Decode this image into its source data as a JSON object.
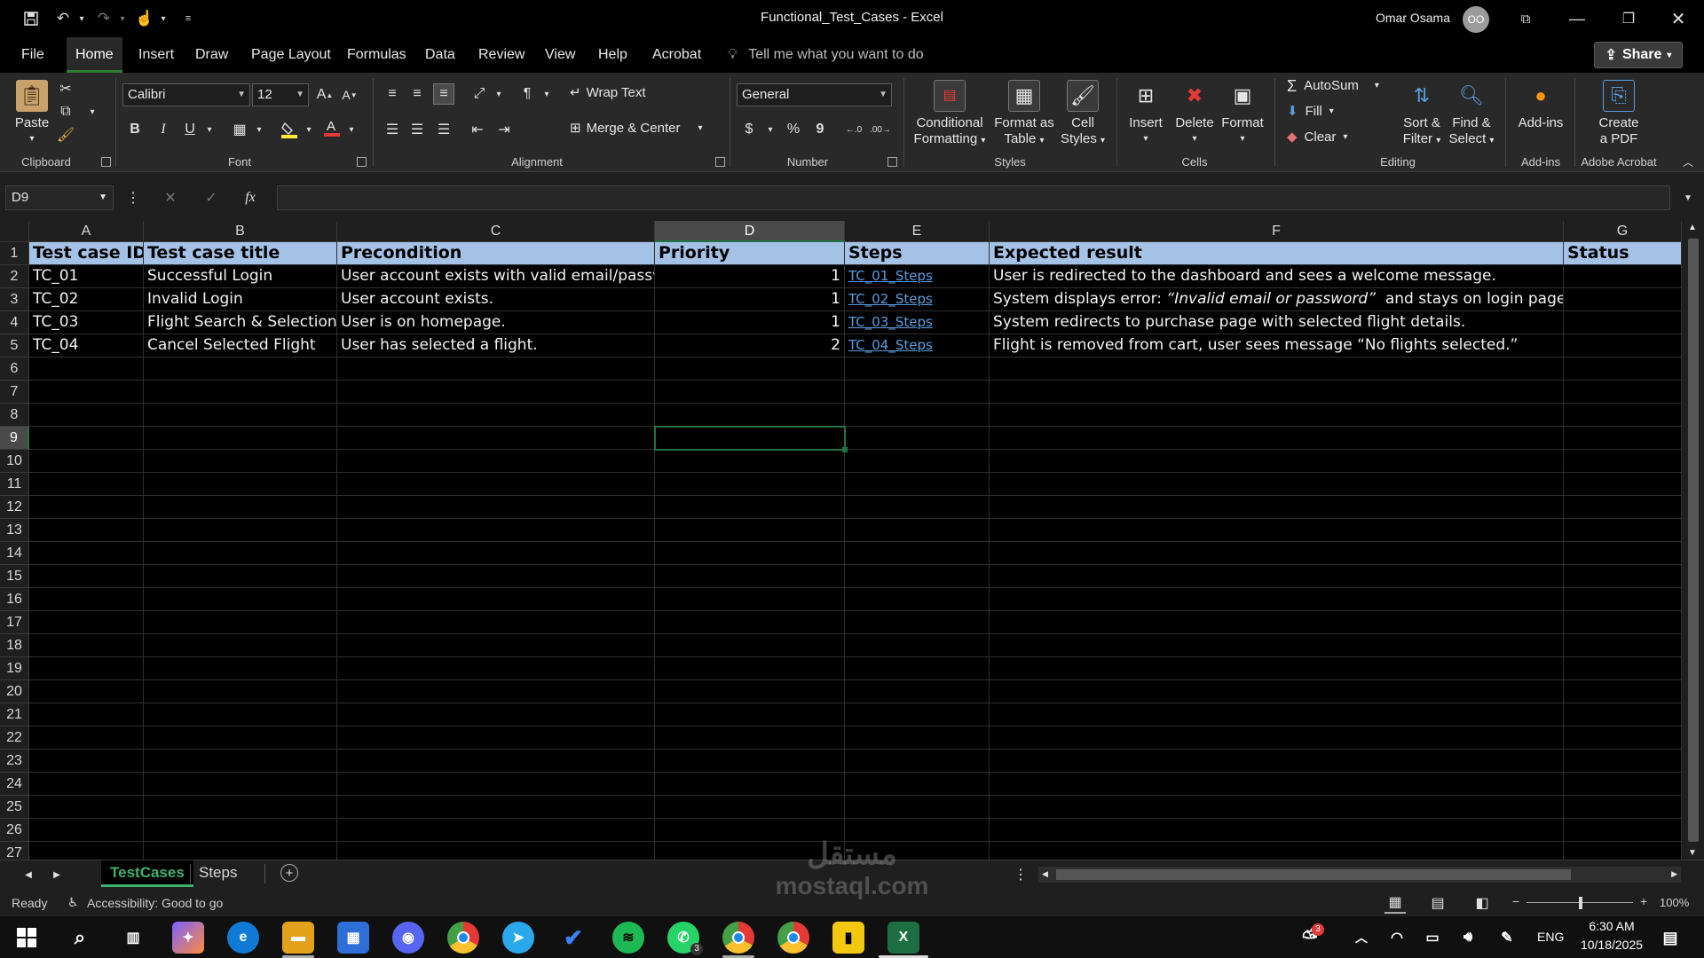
{
  "window": {
    "title": "Functional_Test_Cases  -  Excel",
    "user_name": "Omar Osama",
    "avatar_text": "OO"
  },
  "tabs": [
    "File",
    "Home",
    "Insert",
    "Draw",
    "Page Layout",
    "Formulas",
    "Data",
    "Review",
    "View",
    "Help",
    "Acrobat"
  ],
  "tell_me": "Tell me what you want to do",
  "share_label": "Share",
  "ribbon": {
    "clipboard": {
      "paste": "Paste",
      "label": "Clipboard"
    },
    "font": {
      "name": "Calibri",
      "size": "12",
      "label": "Font",
      "bold": "B",
      "italic": "I",
      "underline": "U"
    },
    "alignment": {
      "wrap": "Wrap Text",
      "merge": "Merge & Center",
      "label": "Alignment"
    },
    "number": {
      "format": "General",
      "label": "Number",
      "currency": "$",
      "percent": "%",
      "comma": "9"
    },
    "styles": {
      "conditional_1": "Conditional",
      "conditional_2": "Formatting",
      "format_table_1": "Format as",
      "format_table_2": "Table",
      "cell_styles_1": "Cell",
      "cell_styles_2": "Styles",
      "label": "Styles"
    },
    "cells": {
      "insert": "Insert",
      "delete": "Delete",
      "format": "Format",
      "label": "Cells"
    },
    "editing": {
      "autosum": "AutoSum",
      "fill": "Fill",
      "clear": "Clear",
      "sort_1": "Sort &",
      "sort_2": "Filter",
      "find_1": "Find &",
      "find_2": "Select",
      "label": "Editing"
    },
    "addins": {
      "button": "Add-ins",
      "label": "Add-ins"
    },
    "acrobat": {
      "btn_1": "Create",
      "btn_2": "a PDF",
      "label": "Adobe Acrobat"
    }
  },
  "formula_bar": {
    "name_box": "D9",
    "fx": "fx",
    "value": ""
  },
  "columns": [
    "A",
    "B",
    "C",
    "D",
    "E",
    "F",
    "G"
  ],
  "rows": [
    "1",
    "2",
    "3",
    "4",
    "5",
    "6",
    "7",
    "8",
    "9",
    "10",
    "11",
    "12",
    "13",
    "14",
    "15",
    "16",
    "17",
    "18",
    "19",
    "20",
    "21",
    "22",
    "23",
    "24",
    "25",
    "26",
    "27"
  ],
  "header_row": [
    "Test case ID",
    "Test case title",
    "Precondition",
    "Priority",
    "Steps",
    "Expected result",
    "Status"
  ],
  "data_rows": [
    {
      "id": "TC_01",
      "title": "Successful Login",
      "pre": "User account exists with valid email/password.",
      "priority": "1",
      "steps": "TC_01_Steps",
      "expected": "User is redirected to the dashboard and sees a welcome message.",
      "status": ""
    },
    {
      "id": "TC_02",
      "title": "Invalid Login",
      "pre": "User account exists.",
      "priority": "1",
      "steps": "TC_02_Steps",
      "expected_prefix": "System displays error: ",
      "expected_italic": "“Invalid email or password”",
      "expected_suffix": "  and stays on login page.",
      "status": ""
    },
    {
      "id": "TC_03",
      "title": "Flight Search & Selection",
      "pre": "User is on homepage.",
      "priority": "1",
      "steps": "TC_03_Steps",
      "expected": "System redirects to purchase page with selected flight details.",
      "status": ""
    },
    {
      "id": "TC_04",
      "title": "Cancel Selected Flight",
      "pre": "User has selected a flight.",
      "priority": "2",
      "steps": "TC_04_Steps",
      "expected": "Flight is removed from cart, user sees message “No flights selected.”",
      "status": ""
    }
  ],
  "sheets": [
    "TestCases",
    "Steps"
  ],
  "status": {
    "ready": "Ready",
    "accessibility": "Accessibility: Good to go",
    "zoom": "100%"
  },
  "taskbar": {
    "lang": "ENG",
    "time": "6:30 AM",
    "date": "10/18/2025",
    "badge_weather": "3",
    "badge_whatsapp": "3"
  },
  "watermark": {
    "line1": "مستقل",
    "line2": "mostaql.com"
  },
  "colors": {
    "accent": "#217346",
    "header_fill": "#a4c2e6",
    "link": "#5a9de0",
    "sheet_active": "#3cb371"
  }
}
